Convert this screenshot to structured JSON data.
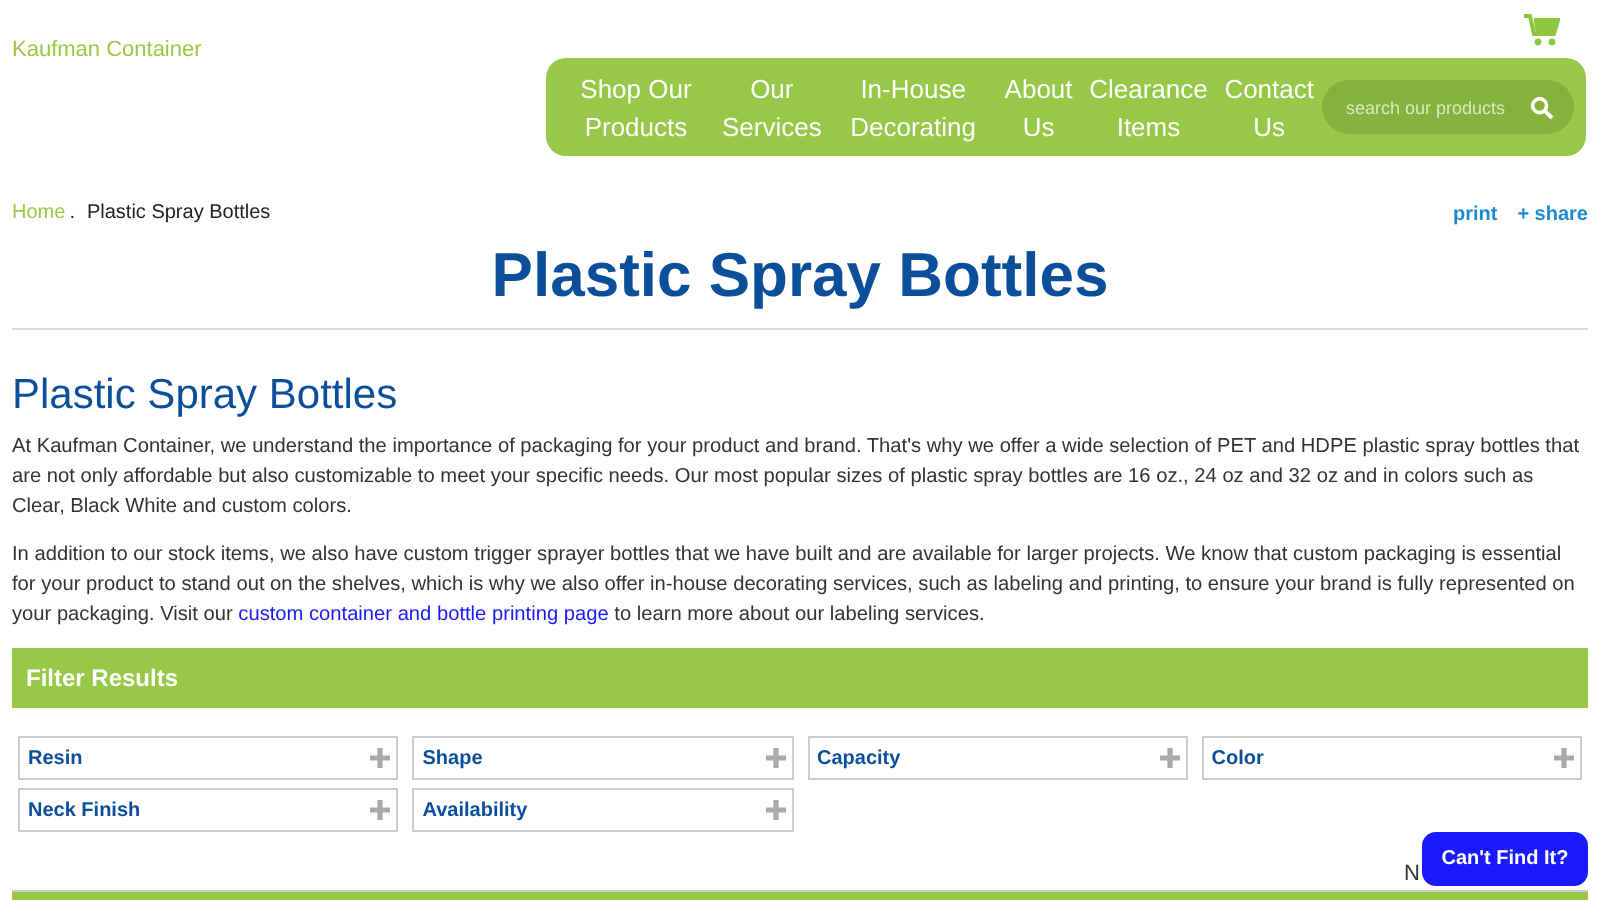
{
  "header": {
    "logo": "Kaufman Container",
    "nav": [
      {
        "label": "Shop Our Products"
      },
      {
        "label": "Our Services"
      },
      {
        "label": "In-House Decorating"
      },
      {
        "label": "About Us"
      },
      {
        "label": "Clearance Items"
      },
      {
        "label": "Contact Us"
      }
    ],
    "search": {
      "placeholder": "search our products"
    }
  },
  "breadcrumb_separator": ".",
  "breadcrumb": [
    {
      "label": "Home",
      "kind": "link"
    },
    {
      "label": "Plastic Spray Bottles",
      "kind": "current"
    }
  ],
  "actions": [
    {
      "label": "print"
    },
    {
      "label": "+ share"
    }
  ],
  "title": "Plastic Spray Bottles",
  "heading": "Plastic Spray Bottles",
  "paragraphs": [
    "At Kaufman Container, we understand the importance of packaging for your product and brand. That's why we offer a wide selection of PET and HDPE plastic spray bottles that are not only affordable but also customizable to meet your specific needs. Our most popular sizes of plastic spray bottles are 16 oz., 24 oz and 32 oz and in colors such as Clear, Black White and custom colors.",
    {
      "text": "In addition to our stock items, we also have custom trigger sprayer bottles that we have built and are available for larger projects. We know that custom packaging is essential for your product to stand out on the shelves, which is why we also offer in-house decorating services, such as labeling and printing, to ensure your brand is fully represented on your packaging. Visit our",
      "link": "custom container and bottle printing page",
      "after": "to learn more about our labeling services."
    }
  ],
  "filter": {
    "title": "Filter Results",
    "groups": [
      {
        "label": "Resin"
      },
      {
        "label": "Shape"
      },
      {
        "label": "Capacity"
      },
      {
        "label": "Color"
      },
      {
        "label": "Neck Finish"
      },
      {
        "label": "Availability"
      }
    ]
  },
  "partial_text": "N",
  "chat_button": "Can't Find It?"
}
